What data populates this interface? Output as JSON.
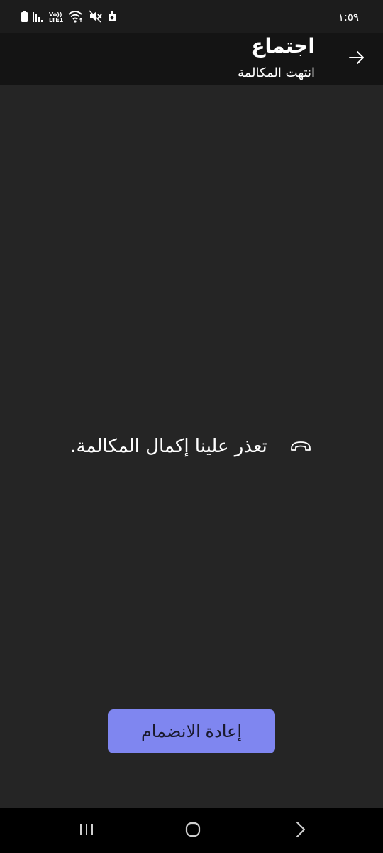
{
  "status_bar": {
    "time": "١:٥٩",
    "volte_top": "Vo))",
    "volte_bottom": "LTE1",
    "icons": [
      "battery-icon",
      "signal-icon",
      "volte-icon",
      "wifi-icon",
      "mute-icon",
      "shield-icon"
    ]
  },
  "header": {
    "title": "اجتماع",
    "subtitle": "انتهت المكالمة",
    "back_icon": "arrow-right-icon"
  },
  "main": {
    "message": "تعذر علينا إكمال المكالمة.",
    "message_icon": "end-call-icon"
  },
  "actions": {
    "rejoin_label": "إعادة الانضمام"
  },
  "nav_bar": {
    "buttons": [
      "recents-icon",
      "home-icon",
      "back-icon"
    ]
  },
  "colors": {
    "background": "#252525",
    "header": "#141414",
    "accent": "#7f86f0",
    "text": "#ffffff"
  }
}
